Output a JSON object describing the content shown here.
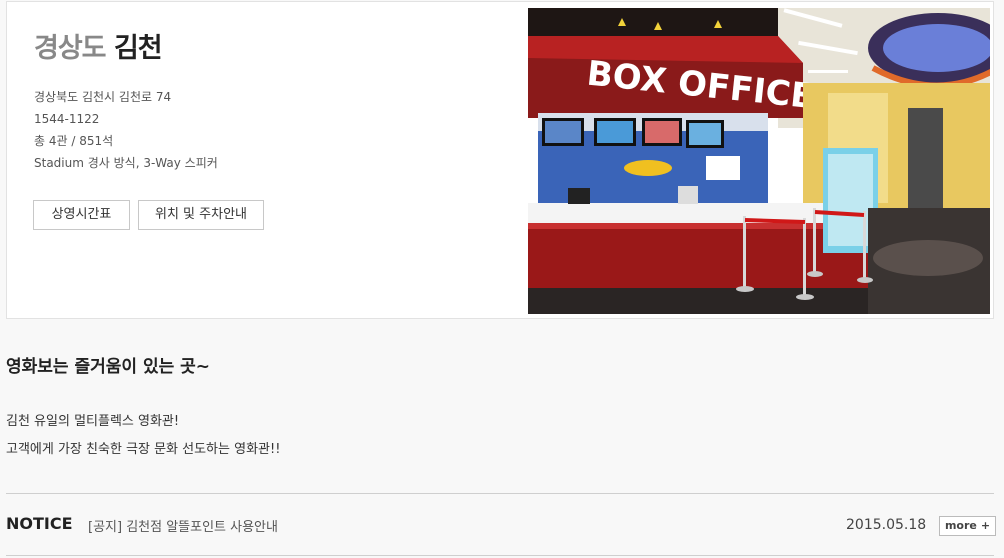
{
  "theater": {
    "region": "경상도",
    "city": "김천",
    "address": "경상북도 김천시 김천로 74",
    "phone": "1544-1122",
    "halls": "총 4관 / 851석",
    "features": "Stadium 경사 방식, 3-Way 스피커",
    "photo_sign": "BOX OFFICE"
  },
  "buttons": {
    "schedule": "상영시간표",
    "location": "위치 및 주차안내"
  },
  "intro": {
    "slogan": "영화보는 즐거움이 있는 곳~",
    "line1": "김천 유일의 멀티플렉스 영화관!",
    "line2": "고객에게 가장 친숙한 극장 문화 선도하는 영화관!!"
  },
  "notice": {
    "label": "NOTICE",
    "title": "[공지] 김천점 알뜰포인트 사용안내",
    "date": "2015.05.18",
    "more": "more",
    "more_icon": "plus-icon"
  }
}
